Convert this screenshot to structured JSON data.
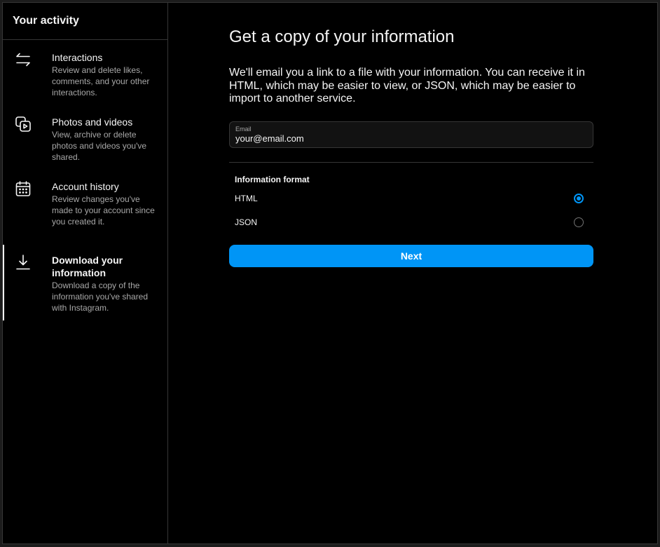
{
  "sidebar": {
    "title": "Your activity",
    "items": [
      {
        "icon": "arrows-swap-icon",
        "title": "Interactions",
        "description": "Review and delete likes, comments, and your other interactions."
      },
      {
        "icon": "photos-videos-icon",
        "title": "Photos and videos",
        "description": "View, archive or delete photos and videos you've shared."
      },
      {
        "icon": "calendar-icon",
        "title": "Account history",
        "description": "Review changes you've made to your account since you created it."
      },
      {
        "icon": "download-icon",
        "title": "Download your information",
        "description": "Download a copy of the information you've shared with Instagram.",
        "active": true
      }
    ]
  },
  "main": {
    "title": "Get a copy of your information",
    "intro": "We'll email you a link to a file with your information. You can receive it in HTML, which may be easier to view, or JSON, which may be easier to import to another service.",
    "email": {
      "label": "Email",
      "value": "your@email.com"
    },
    "format": {
      "heading": "Information format",
      "options": [
        {
          "label": "HTML",
          "selected": true
        },
        {
          "label": "JSON",
          "selected": false
        }
      ]
    },
    "next_label": "Next"
  },
  "colors": {
    "accent": "#0095f6",
    "background": "#000000",
    "border": "#363636",
    "secondary_text": "#a8a8a8"
  }
}
